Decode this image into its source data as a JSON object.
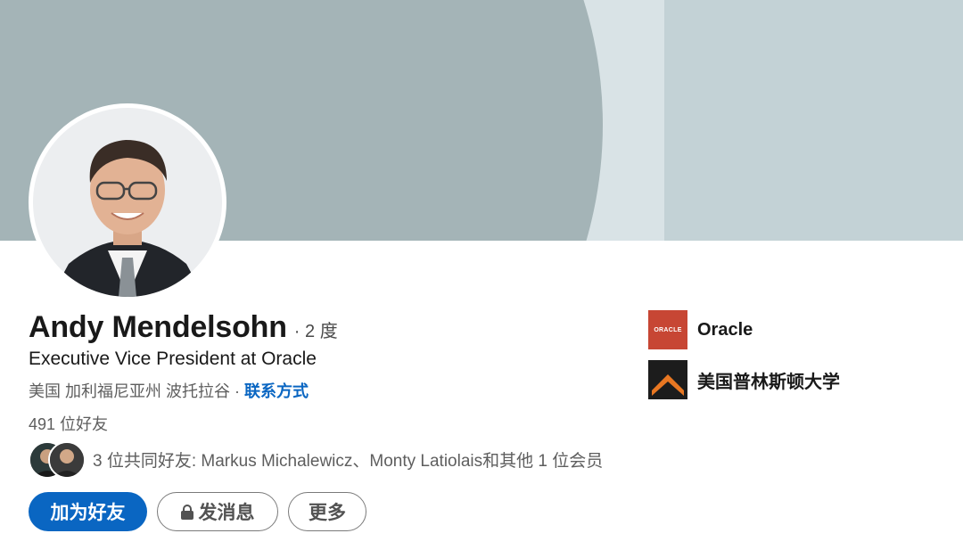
{
  "profile": {
    "name": "Andy Mendelsohn",
    "degree": "· 2 度",
    "headline": "Executive Vice President at Oracle",
    "location": "美国 加利福尼亚州 波托拉谷 · ",
    "contact_link": "联系方式",
    "friends_count": "491 位好友",
    "mutual_text": "3 位共同好友: Markus Michalewicz、Monty Latiolais和其他 1 位会员"
  },
  "actions": {
    "connect": "加为好友",
    "message": "发消息",
    "more": "更多"
  },
  "organizations": [
    {
      "name": "Oracle",
      "logo_text": "ORACLE",
      "logo_color": "#c74634"
    },
    {
      "name": "美国普林斯顿大学",
      "logo_color": "#1c1c1c",
      "accent_color": "#e87722"
    }
  ],
  "colors": {
    "primary": "#0a66c2",
    "cover_dark": "#a4b4b7",
    "cover_light": "#c3d2d6"
  }
}
